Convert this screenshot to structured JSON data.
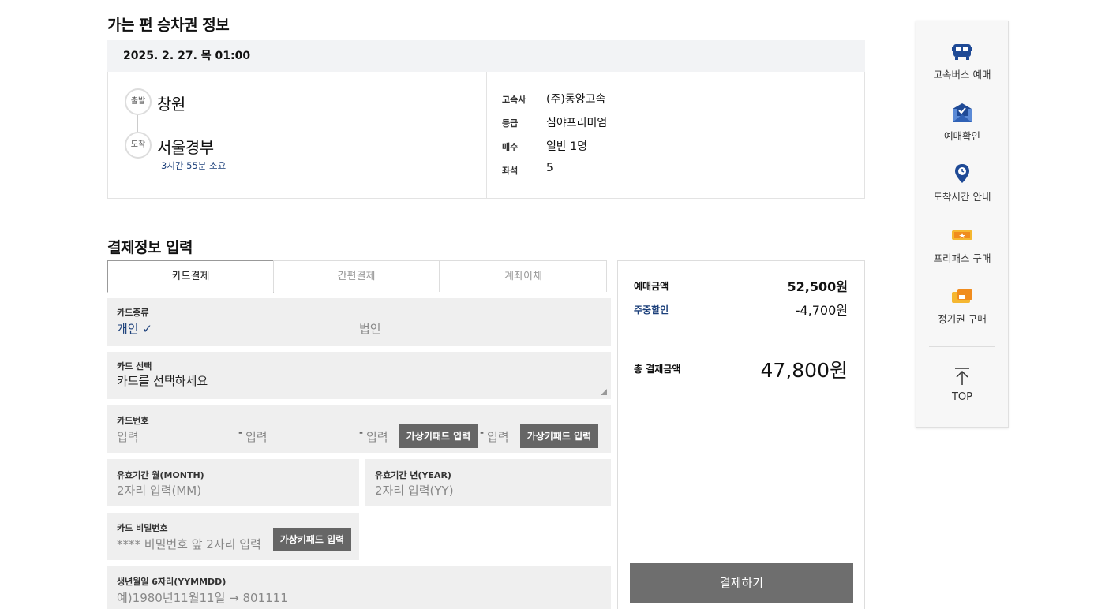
{
  "ticket_section": {
    "title": "가는 편 승차권 정보",
    "date": "2025. 2. 27. 목 01:00",
    "departure": {
      "tag": "출발",
      "city": "창원"
    },
    "arrival": {
      "tag": "도착",
      "city": "서울경부"
    },
    "duration": "3시간 55분 소요",
    "info": [
      {
        "label": "고속사",
        "value": "(주)동양고속"
      },
      {
        "label": "등급",
        "value": "심야프리미엄"
      },
      {
        "label": "매수",
        "value": "일반 1명"
      },
      {
        "label": "좌석",
        "value": "5"
      }
    ]
  },
  "payment_section": {
    "title": "결제정보 입력",
    "tabs": [
      {
        "label": "카드결제"
      },
      {
        "label": "간편결제"
      },
      {
        "label": "계좌이체"
      }
    ],
    "card_type": {
      "label": "카드종류",
      "option_personal": "개인",
      "check_mark": "✓",
      "option_corporate": "법인"
    },
    "card_select": {
      "label": "카드 선택",
      "value": "카드를 선택하세요"
    },
    "card_number": {
      "label": "카드번호",
      "placeholder": "입력",
      "separator": "-",
      "virtual_keypad": "가상키패드 입력"
    },
    "expiry_month": {
      "label": "유효기간 월(MONTH)",
      "placeholder": "2자리 입력(MM)"
    },
    "expiry_year": {
      "label": "유효기간 년(YEAR)",
      "placeholder": "2자리 입력(YY)"
    },
    "card_password": {
      "label": "카드 비밀번호",
      "placeholder": "**** 비밀번호 앞 2자리 입력",
      "virtual_keypad": "가상키패드 입력"
    },
    "birthdate": {
      "label": "생년월일 6자리(YYMMDD)",
      "placeholder": "예)1980년11월11일 → 801111"
    }
  },
  "summary": {
    "reservation_amount_label": "예매금액",
    "reservation_amount": "52,500원",
    "discount_label": "주중할인",
    "discount": "-4,700원",
    "total_label": "총 결제금액",
    "total": "47,800원",
    "pay_button": "결제하기",
    "accent_color": "#1b3f7a"
  },
  "quick_menu": {
    "items": [
      {
        "label": "고속버스 예매",
        "icon": "bus-icon"
      },
      {
        "label": "예매확인",
        "icon": "ticket-check-icon"
      },
      {
        "label": "도착시간 안내",
        "icon": "location-pin-icon"
      },
      {
        "label": "프리패스 구매",
        "icon": "free-pass-ticket-icon"
      },
      {
        "label": "정기권 구매",
        "icon": "season-ticket-icon"
      }
    ],
    "top_label": "TOP"
  }
}
